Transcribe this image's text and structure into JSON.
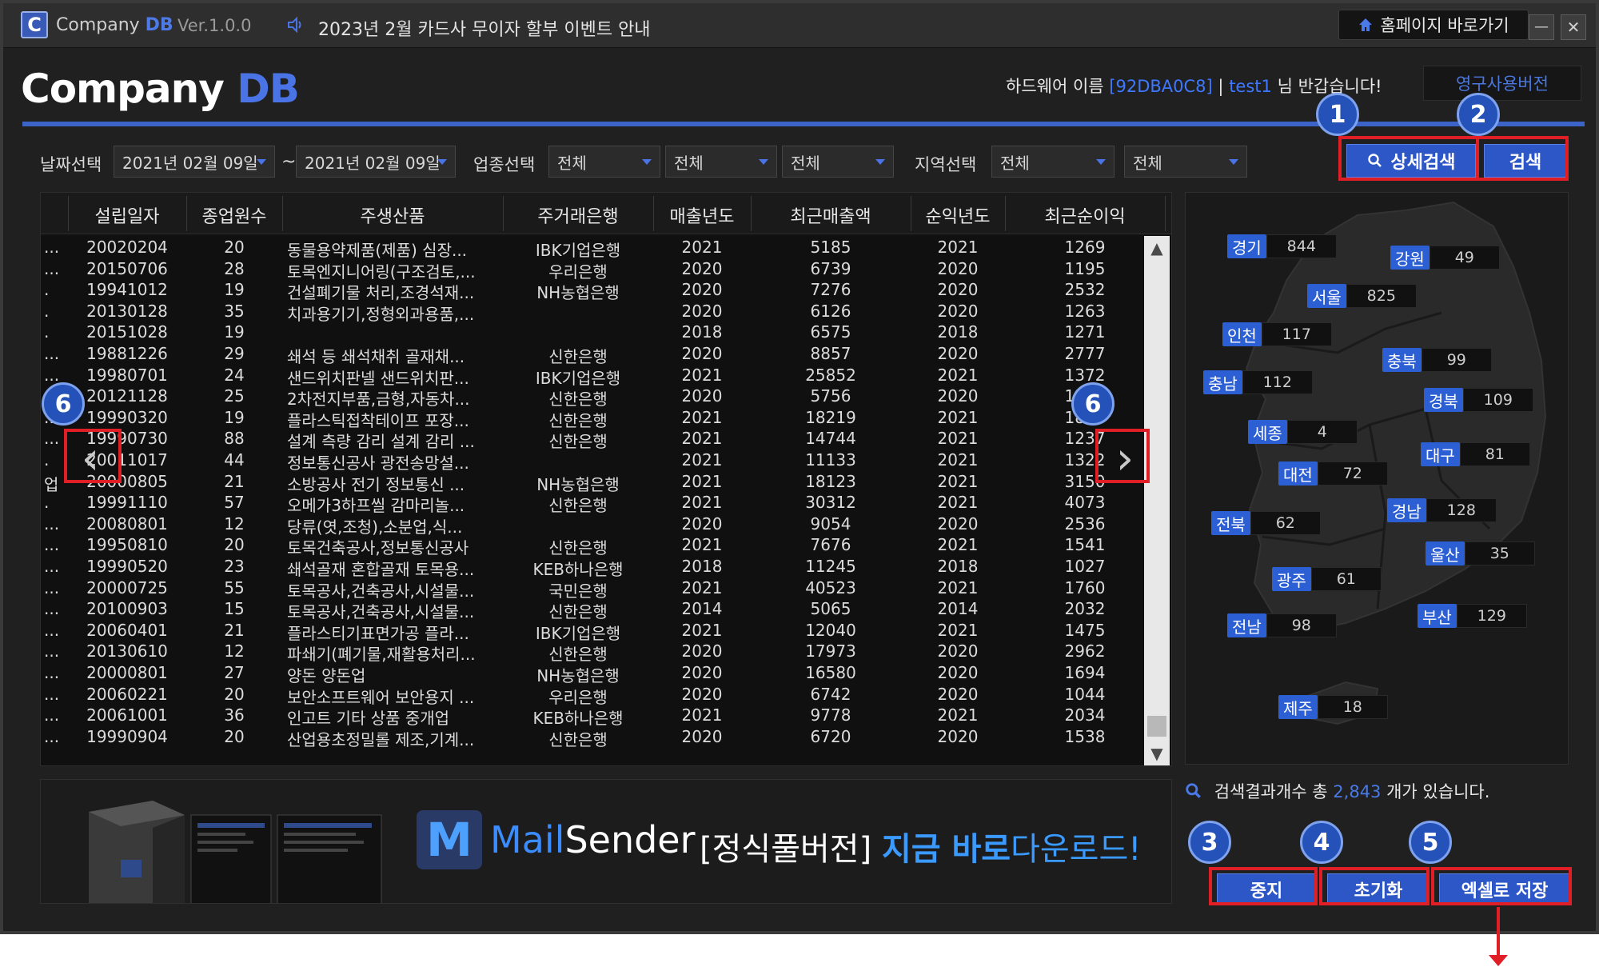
{
  "titlebar": {
    "logo_letter": "C",
    "app_prefix": "Company",
    "app_suffix": "DB",
    "version": "Ver.1.0.0",
    "notice": "2023년 2월 카드사 무이자 할부 이벤트 안내",
    "homepage_label": "홈페이지 바로가기",
    "minimize_glyph": "—",
    "close_glyph": "✕"
  },
  "header": {
    "brand_prefix": "Company",
    "brand_suffix": "DB",
    "hw_label": "하드웨어 이름",
    "hw_id": "[92DBA0C8]",
    "sep": "|",
    "user": "test1",
    "greet_suffix": "님 반갑습니다!",
    "license": "영구사용버전"
  },
  "filters": {
    "date_label": "날짜선택",
    "date_from": "2021년 02월 09일",
    "tilde": "~",
    "date_to": "2021년 02월 09일",
    "industry_label": "업종선택",
    "industry_1": "전체",
    "industry_2": "전체",
    "industry_3": "전체",
    "region_label": "지역선택",
    "region_1": "전체",
    "region_2": "전체",
    "detail_search": "상세검색",
    "search": "검색"
  },
  "table": {
    "columns": [
      "설립일자",
      "종업원수",
      "주생산품",
      "주거래은행",
      "매출년도",
      "최근매출액",
      "순익년도",
      "최근순이익"
    ],
    "rows": [
      [
        "...",
        "20020204",
        "20",
        "동물용약제품(제품) 심장...",
        "IBK기업은행",
        "2021",
        "5185",
        "2021",
        "1269"
      ],
      [
        "...",
        "20150706",
        "28",
        "토목엔지니어링(구조검토,...",
        "우리은행",
        "2020",
        "6739",
        "2020",
        "1195"
      ],
      [
        ".",
        "19941012",
        "19",
        "건설폐기물 처리,조경석재...",
        "NH농협은행",
        "2020",
        "7276",
        "2020",
        "2532"
      ],
      [
        ".",
        "20130128",
        "35",
        "치과용기기,정형외과용품,...",
        "",
        "2020",
        "6126",
        "2020",
        "1263"
      ],
      [
        ".",
        "20151028",
        "19",
        "",
        "",
        "2018",
        "6575",
        "2018",
        "1271"
      ],
      [
        "...",
        "19881226",
        "29",
        "쇄석 등 쇄석채취 골재채...",
        "신한은행",
        "2020",
        "8857",
        "2020",
        "2777"
      ],
      [
        "...",
        "19980701",
        "24",
        "샌드위치판넬 샌드위치판...",
        "IBK기업은행",
        "2021",
        "25852",
        "2021",
        "1372"
      ],
      [
        ".",
        "20121128",
        "25",
        "2차전지부품,금형,자동차...",
        "신한은행",
        "2020",
        "5756",
        "2020",
        "1264"
      ],
      [
        "...",
        "19990320",
        "19",
        "플라스틱접착테이프 포장...",
        "신한은행",
        "2021",
        "18219",
        "2021",
        "1844"
      ],
      [
        "...",
        "19990730",
        "88",
        "설계 측량 감리 설계 감리 ...",
        "신한은행",
        "2021",
        "14744",
        "2021",
        "1237"
      ],
      [
        ".",
        "20011017",
        "44",
        "정보통신공사 광전송망설...",
        "",
        "2021",
        "11133",
        "2021",
        "1322"
      ],
      [
        "업",
        "20000805",
        "21",
        "소방공사 전기 정보통신 ...",
        "NH농협은행",
        "2021",
        "18123",
        "2021",
        "3150"
      ],
      [
        ".",
        "19991110",
        "57",
        "오메가3하프씰 감마리놀...",
        "신한은행",
        "2021",
        "30312",
        "2021",
        "4073"
      ],
      [
        "...",
        "20080801",
        "12",
        "당류(엿,조청),소분업,식...",
        "",
        "2020",
        "9054",
        "2020",
        "2536"
      ],
      [
        "...",
        "19950810",
        "20",
        "토목건축공사,정보통신공사",
        "신한은행",
        "2021",
        "7676",
        "2021",
        "1541"
      ],
      [
        "...",
        "19990520",
        "23",
        "쇄석골재 혼합골재 토목용...",
        "KEB하나은행",
        "2018",
        "11245",
        "2018",
        "1027"
      ],
      [
        "...",
        "20000725",
        "55",
        "토목공사,건축공사,시설물...",
        "국민은행",
        "2021",
        "40523",
        "2021",
        "1760"
      ],
      [
        "...",
        "20100903",
        "15",
        "토목공사,건축공사,시설물...",
        "신한은행",
        "2014",
        "5065",
        "2014",
        "2032"
      ],
      [
        "...",
        "20060401",
        "21",
        "플라스티기표면가공 플라...",
        "IBK기업은행",
        "2021",
        "12040",
        "2021",
        "1475"
      ],
      [
        "...",
        "20130610",
        "12",
        "파쇄기(폐기물,재활용처리...",
        "신한은행",
        "2020",
        "17973",
        "2020",
        "2962"
      ],
      [
        "...",
        "20000801",
        "27",
        "양돈 양돈업",
        "NH농협은행",
        "2020",
        "16580",
        "2020",
        "1694"
      ],
      [
        "...",
        "20060221",
        "20",
        "보안소프트웨어 보안용지 ...",
        "우리은행",
        "2020",
        "6742",
        "2020",
        "1044"
      ],
      [
        "...",
        "20061001",
        "36",
        "인고트 기타 상품 중개업",
        "KEB하나은행",
        "2021",
        "9778",
        "2021",
        "2034"
      ],
      [
        "...",
        "19990904",
        "20",
        "산업용초정밀롤 제조,기계...",
        "신한은행",
        "2020",
        "6720",
        "2020",
        "1538"
      ]
    ],
    "prev_glyph": "‹",
    "next_glyph": "›",
    "scroll_up": "▲",
    "scroll_down": "▼"
  },
  "map": {
    "regions": [
      {
        "name": "경기",
        "count": "844"
      },
      {
        "name": "강원",
        "count": "49"
      },
      {
        "name": "서울",
        "count": "825"
      },
      {
        "name": "인천",
        "count": "117"
      },
      {
        "name": "충북",
        "count": "99"
      },
      {
        "name": "충남",
        "count": "112"
      },
      {
        "name": "경북",
        "count": "109"
      },
      {
        "name": "세종",
        "count": "4"
      },
      {
        "name": "대구",
        "count": "81"
      },
      {
        "name": "대전",
        "count": "72"
      },
      {
        "name": "경남",
        "count": "128"
      },
      {
        "name": "전북",
        "count": "62"
      },
      {
        "name": "울산",
        "count": "35"
      },
      {
        "name": "광주",
        "count": "61"
      },
      {
        "name": "부산",
        "count": "129"
      },
      {
        "name": "전남",
        "count": "98"
      },
      {
        "name": "제주",
        "count": "18"
      }
    ]
  },
  "result": {
    "prefix": "검색결과개수 총",
    "count": "2,843",
    "suffix": "개가 있습니다."
  },
  "actions": {
    "stop": "중지",
    "reset": "초기화",
    "excel": "엑셀로 저장"
  },
  "banner": {
    "logo_letter": "M",
    "name_part1": "Mail",
    "name_part2": "Sender",
    "promo_part1": "[정식풀버전]",
    "promo_part2": "지금 바로",
    "promo_part3": "다운로드!"
  },
  "callouts": [
    "1",
    "2",
    "3",
    "4",
    "5",
    "6",
    "6"
  ],
  "colors": {
    "accent": "#3c63c8",
    "highlight_box": "#e01e26",
    "region_tag": "#2c5fd4"
  }
}
